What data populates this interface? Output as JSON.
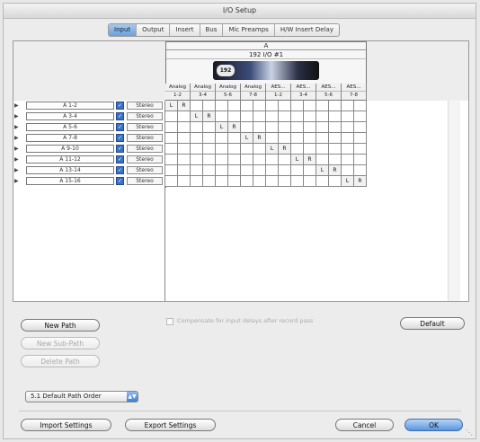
{
  "window": {
    "title": "I/O Setup"
  },
  "tabs": [
    {
      "label": "Input",
      "active": true
    },
    {
      "label": "Output",
      "active": false
    },
    {
      "label": "Insert",
      "active": false
    },
    {
      "label": "Bus",
      "active": false
    },
    {
      "label": "Mic Preamps",
      "active": false
    },
    {
      "label": "H/W Insert Delay",
      "active": false
    }
  ],
  "device": {
    "letter": "A",
    "name": "192 I/O #1",
    "logo_text": "192"
  },
  "channels": [
    {
      "type": "Analog",
      "range": "1-2"
    },
    {
      "type": "Analog",
      "range": "3-4"
    },
    {
      "type": "Analog",
      "range": "5-6"
    },
    {
      "type": "Analog",
      "range": "7-8"
    },
    {
      "type": "AES...",
      "range": "1-2"
    },
    {
      "type": "AES...",
      "range": "3-4"
    },
    {
      "type": "AES...",
      "range": "5-6"
    },
    {
      "type": "AES...",
      "range": "7-8"
    }
  ],
  "paths": [
    {
      "name": "A 1-2",
      "format": "Stereo",
      "checked": true
    },
    {
      "name": "A 3-4",
      "format": "Stereo",
      "checked": true
    },
    {
      "name": "A 5-6",
      "format": "Stereo",
      "checked": true
    },
    {
      "name": "A 7-8",
      "format": "Stereo",
      "checked": true
    },
    {
      "name": "A 9-10",
      "format": "Stereo",
      "checked": true
    },
    {
      "name": "A 11-12",
      "format": "Stereo",
      "checked": true
    },
    {
      "name": "A 13-14",
      "format": "Stereo",
      "checked": true
    },
    {
      "name": "A 15-16",
      "format": "Stereo",
      "checked": true
    }
  ],
  "grid_labels": {
    "left": "L",
    "right": "R"
  },
  "buttons": {
    "new_path": "New Path",
    "new_sub_path": "New Sub-Path",
    "delete_path": "Delete Path",
    "default": "Default",
    "import_settings": "Import Settings",
    "export_settings": "Export Settings",
    "cancel": "Cancel",
    "ok": "OK"
  },
  "compensate_label": "Compensate for input delays after record pass",
  "path_order": {
    "selected": "5.1 Default Path Order"
  }
}
